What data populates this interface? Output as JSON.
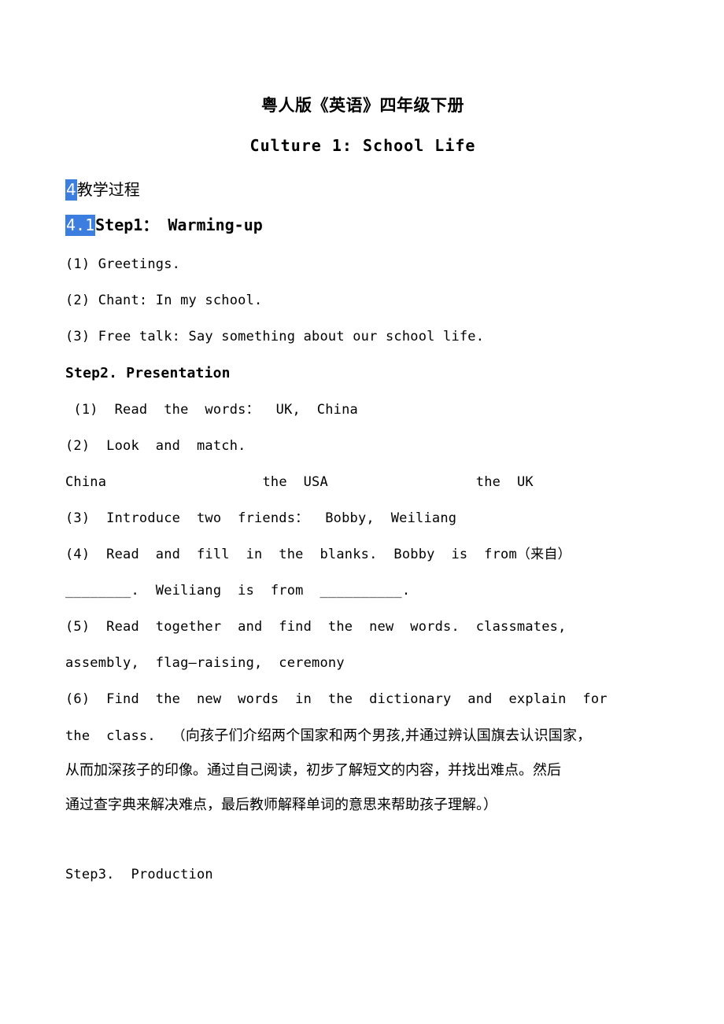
{
  "document": {
    "title_cn": "粤人版《英语》四年级下册",
    "title_en": "Culture 1: School Life",
    "section": {
      "number": "4",
      "label": "教学过程"
    },
    "subsection": {
      "number": "4.1",
      "label": "Step1：  Warming-up"
    },
    "step1_items": [
      "(1) Greetings.",
      "(2) Chant: In my school.",
      "(3) Free talk: Say something about our school life."
    ],
    "step2_heading": "Step2. Presentation",
    "step2_items": {
      "item1": " (1)  Read  the  words：  UK,  China",
      "item2": "(2)  Look  and  match.",
      "match_row": {
        "left": "China",
        "middle": "the  USA",
        "right": "the  UK"
      },
      "item3": "(3)  Introduce  two  friends：  Bobby,  Weiliang",
      "item4_line1": "(4)  Read  and  fill  in  the  blanks.  Bobby  is  from（来自）",
      "item4_line2": "________.  Weiliang  is  from  __________.",
      "item5_line1": "(5)  Read  together  and  find  the  new  words.  classmates,",
      "item5_line2": "assembly,  flag—raising,  ceremony",
      "item6_line1": "(6)  Find  the  new  words  in  the  dictionary  and  explain  for",
      "item6_line2_en": "the  class.  （",
      "item6_line2_cn": "向孩子们介绍两个国家和两个男孩,并通过辨认国旗去认识国家，",
      "item6_line3_cn": "从而加深孩子的印像。通过自己阅读，初步了解短文的内容，并找出难点。然后",
      "item6_line4_cn": "通过查字典来解决难点，最后教师解释单词的意思来帮助孩子理解。）"
    },
    "step3_heading": "Step3.  Production",
    "colors": {
      "highlight_background": "#3c7ee0",
      "highlight_text": "#ffffff",
      "page_background": "#ffffff",
      "text": "#000000"
    }
  }
}
